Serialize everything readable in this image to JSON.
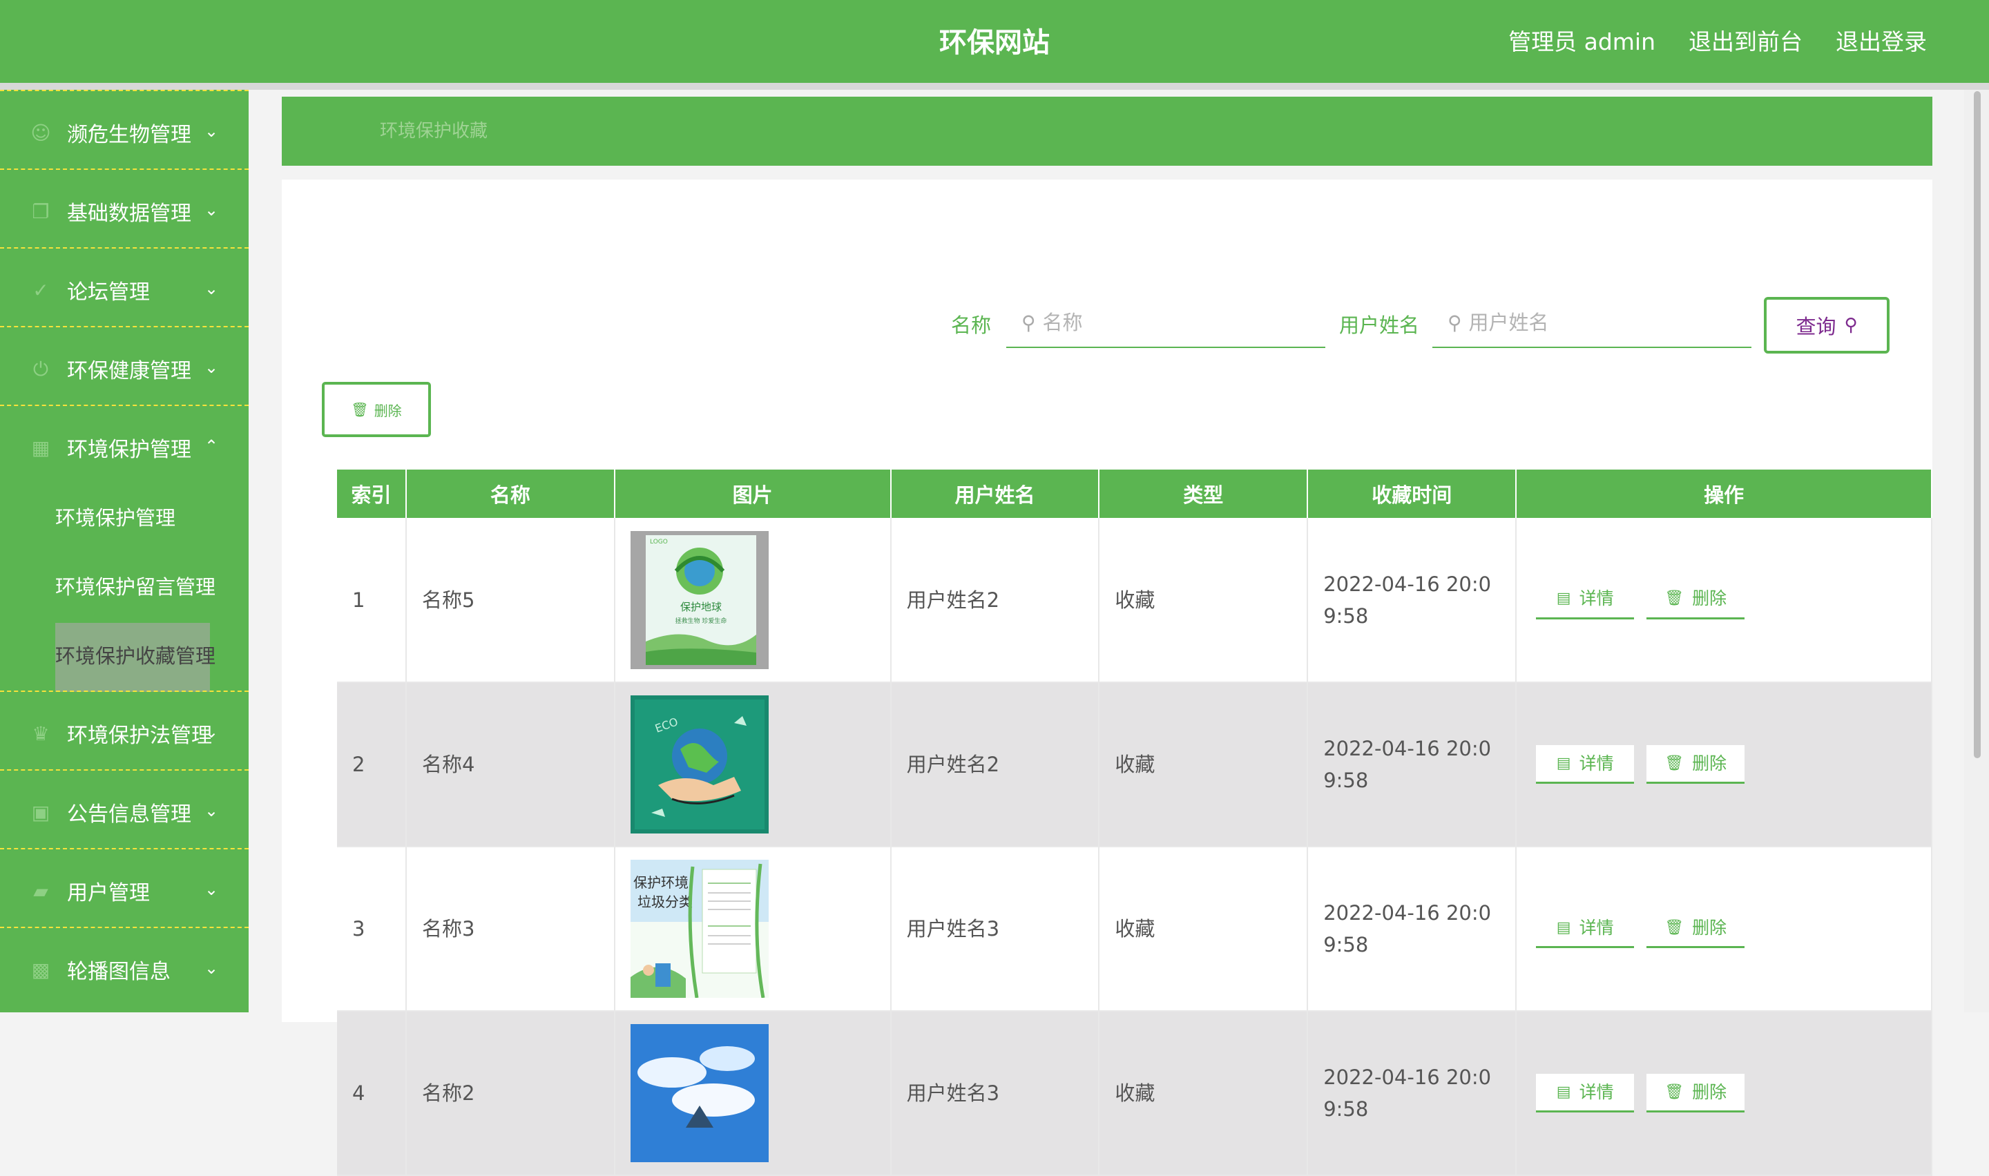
{
  "header": {
    "title": "环保网站",
    "user": "管理员 admin",
    "to_front": "退出到前台",
    "logout": "退出登录"
  },
  "sidebar": {
    "items": [
      {
        "label": "濒危生物管理",
        "icon": "paw-icon"
      },
      {
        "label": "基础数据管理",
        "icon": "database-icon"
      },
      {
        "label": "论坛管理",
        "icon": "check-circle-icon"
      },
      {
        "label": "环保健康管理",
        "icon": "power-icon"
      },
      {
        "label": "环境保护管理",
        "icon": "briefcase-icon",
        "expanded": true,
        "children": [
          "环境保护管理",
          "环境保护留言管理",
          "环境保护收藏管理"
        ]
      },
      {
        "label": "环境保护法管理",
        "icon": "trophy-icon"
      },
      {
        "label": "公告信息管理",
        "icon": "notice-icon"
      },
      {
        "label": "用户管理",
        "icon": "folder-icon"
      },
      {
        "label": "轮播图信息",
        "icon": "image-icon"
      }
    ]
  },
  "breadcrumb": "环境保护收藏",
  "search": {
    "name_label": "名称",
    "name_placeholder": "名称",
    "user_label": "用户姓名",
    "user_placeholder": "用户姓名",
    "query_button": "查询"
  },
  "batch_delete": "删除",
  "table": {
    "columns": [
      "索引",
      "名称",
      "图片",
      "用户姓名",
      "类型",
      "收藏时间",
      "操作"
    ],
    "rows": [
      {
        "index": "1",
        "name": "名称5",
        "image": "poster-protect-earth",
        "user": "用户姓名2",
        "type": "收藏",
        "time": "2022-04-16 20:09:58"
      },
      {
        "index": "2",
        "name": "名称4",
        "image": "poster-eco-hands",
        "user": "用户姓名2",
        "type": "收藏",
        "time": "2022-04-16 20:09:58"
      },
      {
        "index": "3",
        "name": "名称3",
        "image": "poster-garbage-sorting",
        "user": "用户姓名3",
        "type": "收藏",
        "time": "2022-04-16 20:09:58"
      },
      {
        "index": "4",
        "name": "名称2",
        "image": "poster-sky",
        "user": "用户姓名3",
        "type": "收藏",
        "time": "2022-04-16 20:09:58"
      }
    ],
    "detail_label": "详情",
    "delete_label": "删除"
  },
  "thumb_texts": {
    "protect_earth": "保护地球",
    "protect_sub": "拯救生物 珍爱生命",
    "logo": "LOGO",
    "eco": "ECO",
    "garbage_title_1": "保护环境",
    "garbage_title_2": "垃圾分类"
  },
  "colors": {
    "brand_green": "#5bb551",
    "alt_row": "#e4e3e4",
    "query_text": "#7d2a8e",
    "dashed_divider": "#f6e23b"
  }
}
